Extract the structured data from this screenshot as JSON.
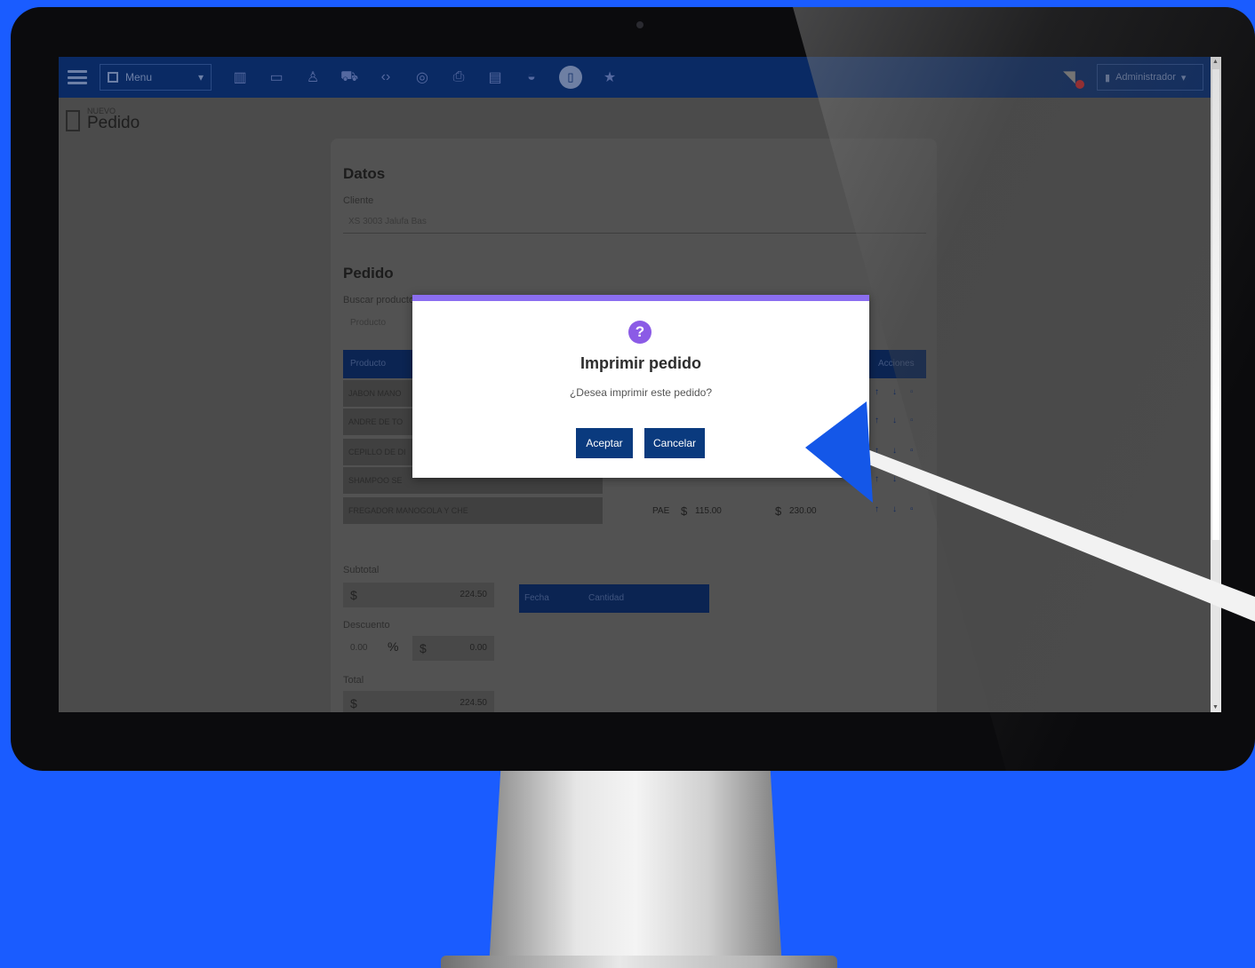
{
  "topbar": {
    "menu_label": "Menu",
    "admin_label": "Administrador",
    "icons": [
      "bar-chart-icon",
      "monitor-icon",
      "user-icon",
      "truck-icon",
      "code-icon",
      "globe-icon",
      "printer-icon",
      "folder-icon",
      "basket-icon",
      "clipboard-icon",
      "star-icon"
    ]
  },
  "page": {
    "subtitle": "NUEVO",
    "title": "Pedido"
  },
  "datos": {
    "section_title": "Datos",
    "cliente_label": "Cliente",
    "cliente_value": "XS 3003 Jalufa Bas"
  },
  "pedido": {
    "section_title": "Pedido",
    "buscar_label": "Buscar producto",
    "buscar_placeholder": "Producto",
    "columns": {
      "producto": "Producto",
      "acciones": "Acciones"
    },
    "rows": [
      {
        "producto": "JABON MANO"
      },
      {
        "producto": "ANDRE DE TO"
      },
      {
        "producto": "CEPILLO DE DI"
      },
      {
        "producto": "SHAMPOO SE"
      },
      {
        "producto": "FREGADOR MANOGOLA Y CHE",
        "unidad": "PAE",
        "precio": "115.00",
        "importe": "230.00"
      }
    ],
    "currency_symbol": "$"
  },
  "totales": {
    "subtotal_label": "Subtotal",
    "subtotal_value": "224.50",
    "descuento_label": "Descuento",
    "descuento_pct": "0.00",
    "pct_symbol": "%",
    "descuento_value": "0.00",
    "total_label": "Total",
    "total_value": "224.50",
    "pagos_columns": {
      "fecha": "Fecha",
      "cantidad": "Cantidad"
    }
  },
  "modal": {
    "title": "Imprimir pedido",
    "message": "¿Desea imprimir este pedido?",
    "accept_label": "Aceptar",
    "cancel_label": "Cancelar",
    "accent_color": "#8b6ef0",
    "button_color": "#0a3a7e"
  },
  "colors": {
    "background": "#1a5cff",
    "topbar": "#0a2a64",
    "pointer": "#1457e8"
  }
}
